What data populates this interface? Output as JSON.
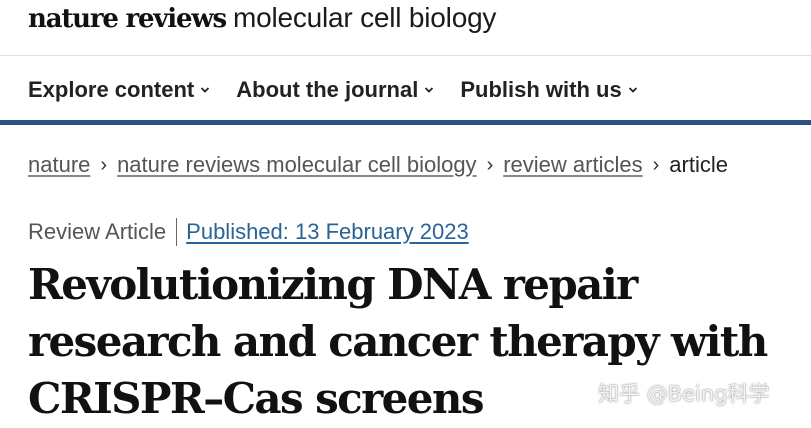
{
  "brand": {
    "bold": "nature reviews",
    "light": "molecular cell biology"
  },
  "nav": {
    "items": [
      {
        "label": "Explore content"
      },
      {
        "label": "About the journal"
      },
      {
        "label": "Publish with us"
      }
    ]
  },
  "breadcrumb": {
    "items": [
      "nature",
      "nature reviews molecular cell biology",
      "review articles"
    ],
    "current": "article",
    "separator": "›"
  },
  "article": {
    "type": "Review Article",
    "published": "Published: 13 February 2023",
    "title": "Revolutionizing DNA repair research and cancer therapy with CRISPR–Cas screens"
  },
  "watermark": "知乎 @Being科学",
  "colors": {
    "accent_rule": "#2a5286",
    "link": "#2a6496"
  },
  "icons": {
    "nav_chevron": "chevron-down-icon"
  }
}
